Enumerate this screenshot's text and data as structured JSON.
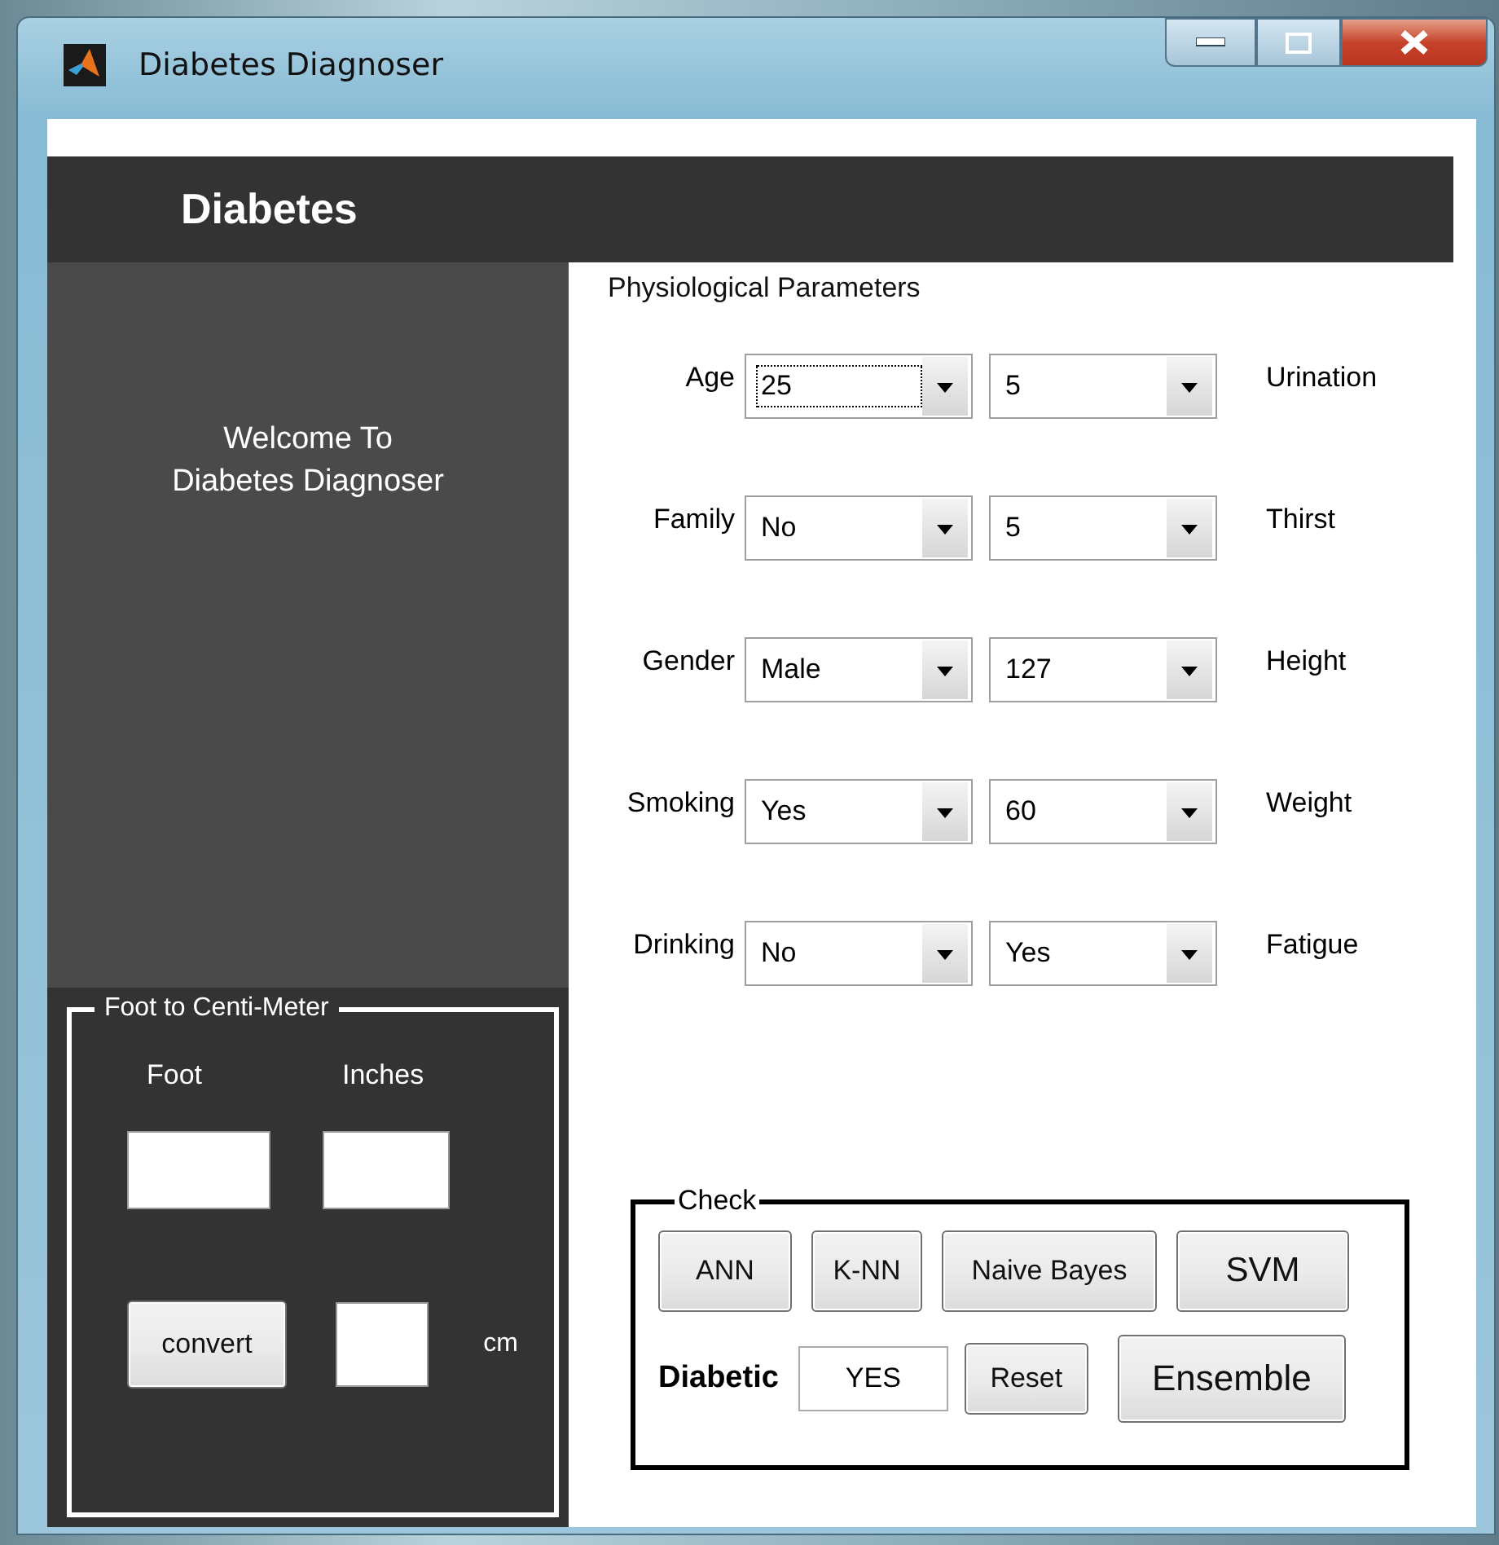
{
  "window": {
    "title": "Diabetes Diagnoser"
  },
  "header": {
    "title": "Diabetes"
  },
  "welcome": {
    "text": "Welcome To\nDiabetes Diagnoser"
  },
  "converter": {
    "title": "Foot to Centi-Meter",
    "foot_label": "Foot",
    "inches_label": "Inches",
    "convert_button": "convert",
    "unit": "cm"
  },
  "parameters": {
    "title": "Physiological Parameters",
    "rows": [
      {
        "left_label": "Age",
        "left_value": "25",
        "left_focused": true,
        "right_value": "5",
        "right_label": "Urination"
      },
      {
        "left_label": "Family",
        "left_value": "No",
        "left_focused": false,
        "right_value": "5",
        "right_label": "Thirst"
      },
      {
        "left_label": "Gender",
        "left_value": "Male",
        "left_focused": false,
        "right_value": "127",
        "right_label": "Height"
      },
      {
        "left_label": "Smoking",
        "left_value": "Yes",
        "left_focused": false,
        "right_value": "60",
        "right_label": "Weight"
      },
      {
        "left_label": "Drinking",
        "left_value": "No",
        "left_focused": false,
        "right_value": "Yes",
        "right_label": "Fatigue"
      }
    ]
  },
  "check": {
    "title": "Check",
    "buttons": [
      "ANN",
      "K-NN",
      "Naive Bayes",
      "SVM"
    ],
    "result_label": "Diabetic",
    "result_value": "YES",
    "reset_button": "Reset",
    "ensemble_button": "Ensemble"
  }
}
